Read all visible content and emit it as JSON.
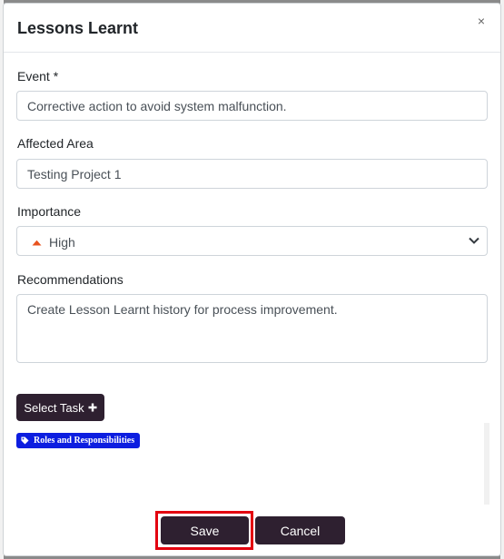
{
  "modal": {
    "title": "Lessons Learnt",
    "close_symbol": "×"
  },
  "form": {
    "event": {
      "label": "Event *",
      "value": "Corrective action to avoid system malfunction."
    },
    "affected_area": {
      "label": "Affected Area",
      "value": "Testing Project 1"
    },
    "importance": {
      "label": "Importance",
      "value": "High",
      "icon": "priority-up-icon",
      "icon_color": "#e8531f"
    },
    "recommendations": {
      "label": "Recommendations",
      "value": "Create Lesson Learnt history for process improvement."
    }
  },
  "tasks": {
    "select_button_label": "Select Task",
    "tags": [
      {
        "label": "Roles and Responsibilities",
        "icon": "tag-icon",
        "color": "#0d1ee0"
      }
    ]
  },
  "footer": {
    "save_label": "Save",
    "cancel_label": "Cancel"
  },
  "colors": {
    "primary_button": "#2e2030",
    "highlight": "#e3000f"
  }
}
